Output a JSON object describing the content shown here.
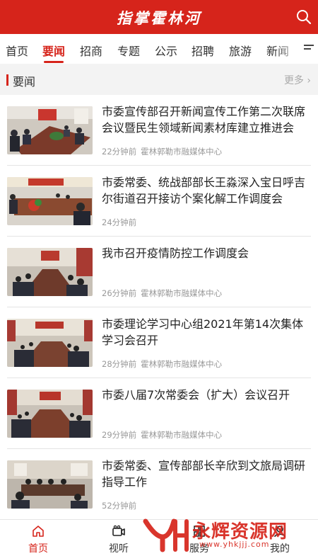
{
  "header": {
    "brand": "指掌霍林河",
    "search_icon": "search-icon"
  },
  "tabs": [
    {
      "label": "首页",
      "active": false
    },
    {
      "label": "要闻",
      "active": true
    },
    {
      "label": "招商",
      "active": false
    },
    {
      "label": "专题",
      "active": false
    },
    {
      "label": "公示",
      "active": false
    },
    {
      "label": "招聘",
      "active": false
    },
    {
      "label": "旅游",
      "active": false
    },
    {
      "label": "新闻",
      "active": false
    }
  ],
  "section": {
    "title": "要闻",
    "more": "更多"
  },
  "news": [
    {
      "title": "市委宣传部召开新闻宣传工作第二次联席会议暨民生领域新闻素材库建立推进会",
      "time": "22分钟前",
      "source": "霍林郭勒市融媒体中心"
    },
    {
      "title": "市委常委、统战部部长王淼深入宝日呼吉尔街道召开接访个案化解工作调度会",
      "time": "24分钟前",
      "source": ""
    },
    {
      "title": "我市召开疫情防控工作调度会",
      "time": "26分钟前",
      "source": "霍林郭勒市融媒体中心"
    },
    {
      "title": "市委理论学习中心组2021年第14次集体学习会召开",
      "time": "28分钟前",
      "source": "霍林郭勒市融媒体中心"
    },
    {
      "title": "市委八届7次常委会（扩大）会议召开",
      "time": "29分钟前",
      "source": "霍林郭勒市融媒体中心"
    },
    {
      "title": "市委常委、宣传部部长辛欣到文旅局调研指导工作",
      "time": "52分钟前",
      "source": ""
    }
  ],
  "bottom_nav": [
    {
      "label": "首页",
      "icon": "home-icon",
      "active": true
    },
    {
      "label": "视听",
      "icon": "video-icon",
      "active": false
    },
    {
      "label": "服务",
      "icon": "service-icon",
      "active": false
    },
    {
      "label": "我的",
      "icon": "user-icon",
      "active": false
    }
  ],
  "watermark": {
    "text": "永辉资源网",
    "url": "www.yhkjjj.com"
  },
  "colors": {
    "accent": "#d6241b",
    "muted": "#999999",
    "section_bg": "#f3f3f3"
  }
}
